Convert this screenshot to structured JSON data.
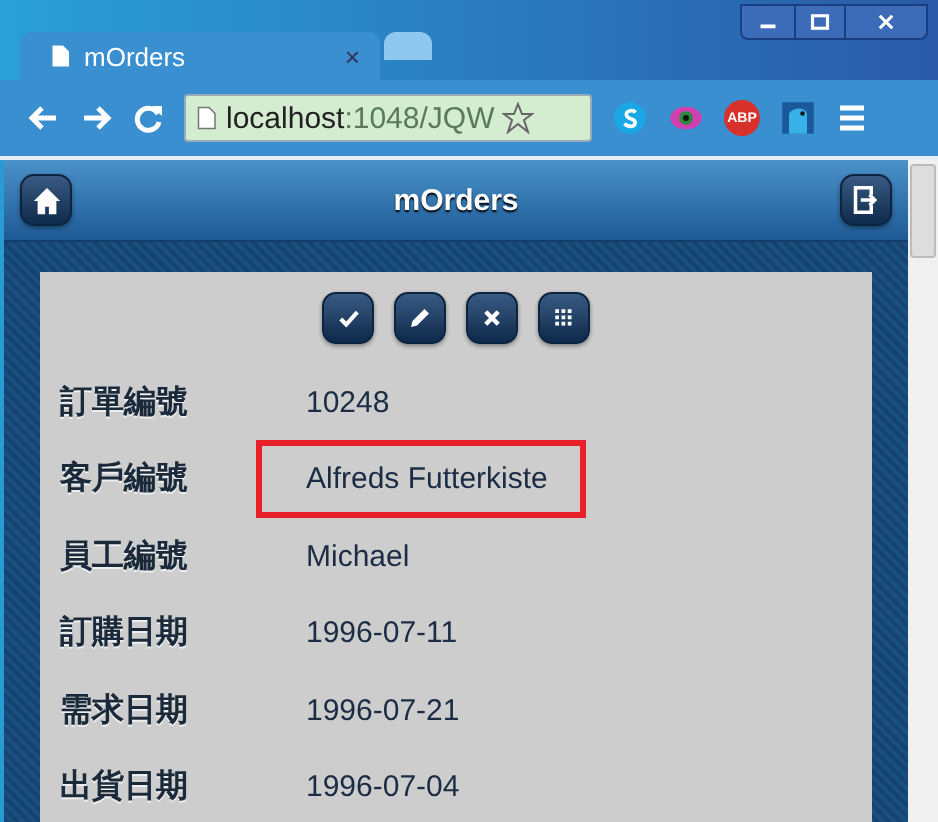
{
  "browser": {
    "tabs": [
      {
        "title": "mOrders",
        "selected": true
      },
      {
        "selected": false
      }
    ],
    "close_tab": "×",
    "address": {
      "host": "localhost",
      "path": ":1048/JQW"
    },
    "abp_label": "ABP"
  },
  "app": {
    "header": {
      "title": "mOrders"
    },
    "toolbar": [
      {
        "kind": "check"
      },
      {
        "kind": "edit"
      },
      {
        "kind": "delete"
      },
      {
        "kind": "grid"
      }
    ],
    "fields": [
      {
        "label": "訂單編號",
        "value": "10248",
        "highlighted": false
      },
      {
        "label": "客戶編號",
        "value": "Alfreds Futterkiste",
        "highlighted": true
      },
      {
        "label": "員工編號",
        "value": "Michael",
        "highlighted": false
      },
      {
        "label": "訂購日期",
        "value": "1996-07-11",
        "highlighted": false
      },
      {
        "label": "需求日期",
        "value": "1996-07-21",
        "highlighted": false
      },
      {
        "label": "出貨日期",
        "value": "1996-07-04",
        "highlighted": false
      }
    ]
  }
}
